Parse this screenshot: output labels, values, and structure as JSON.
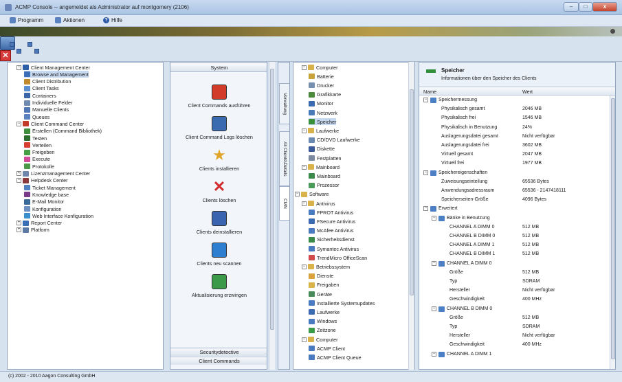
{
  "window": {
    "title": "ACMP Console -- angemeldet als Administrator auf montgomery (2106)",
    "min": "–",
    "max": "□",
    "close": "x"
  },
  "menu": [
    {
      "label": "Programm",
      "icon": "program-icon"
    },
    {
      "label": "Aktionen",
      "icon": "actions-icon"
    },
    {
      "label": "Hilfe",
      "icon": "help-icon"
    }
  ],
  "left_tree": [
    {
      "label": "Client Management Center",
      "level": 0,
      "exp": "-",
      "icon": "#2e5ea8"
    },
    {
      "label": "Browse and Management",
      "level": 1,
      "icon": "#3a6fb8",
      "selected": true
    },
    {
      "label": "Client Distribution",
      "level": 1,
      "icon": "#c48a2a"
    },
    {
      "label": "Client Tasks",
      "level": 1,
      "icon": "#5b8fcf"
    },
    {
      "label": "Containers",
      "level": 1,
      "icon": "#3a64a8"
    },
    {
      "label": "Individuelle Felder",
      "level": 1,
      "icon": "#6f8bb0"
    },
    {
      "label": "Manuelle Clients",
      "level": 1,
      "icon": "#4f78b5"
    },
    {
      "label": "Queues",
      "level": 1,
      "icon": "#5b82c0"
    },
    {
      "label": "Client Command Center",
      "level": 0,
      "exp": "-",
      "icon": "#c23b2b"
    },
    {
      "label": "Erstellen (Command Bibliothek)",
      "level": 1,
      "icon": "#3f8f3f"
    },
    {
      "label": "Testen",
      "level": 1,
      "icon": "#2d6d2d"
    },
    {
      "label": "Verteilen",
      "level": 1,
      "icon": "#d6402f"
    },
    {
      "label": "Freigeben",
      "level": 1,
      "icon": "#45a045"
    },
    {
      "label": "Execute",
      "level": 1,
      "icon": "#d04a9a"
    },
    {
      "label": "Protokolle",
      "level": 1,
      "icon": "#4a9a4a"
    },
    {
      "label": "Lizenzmanagement Center",
      "level": 0,
      "exp": "+",
      "icon": "#6f87ad"
    },
    {
      "label": "Helpdesk Center",
      "level": 0,
      "exp": "-",
      "icon": "#8a3a3a"
    },
    {
      "label": "Ticket Management",
      "level": 1,
      "icon": "#5080c0"
    },
    {
      "label": "Knowledge base",
      "level": 1,
      "icon": "#7a3a8a"
    },
    {
      "label": "E-Mail Monitor",
      "level": 1,
      "icon": "#3a6a9a"
    },
    {
      "label": "Konfiguration",
      "level": 1,
      "icon": "#6a8fc0"
    },
    {
      "label": "Web Interface Konfiguration",
      "level": 1,
      "icon": "#3a8fcf"
    },
    {
      "label": "Report Center",
      "level": 0,
      "exp": "+",
      "icon": "#3a6fb8"
    },
    {
      "label": "Platform",
      "level": 0,
      "exp": "+",
      "icon": "#5a7aa8"
    }
  ],
  "middle": {
    "header": "System",
    "actions": [
      {
        "label": "Client Commands ausführen",
        "icon": "puzzle-run-icon"
      },
      {
        "label": "Client Command Logs löschen",
        "icon": "log-delete-icon"
      },
      {
        "label": "Clients installieren",
        "icon": "install-star-icon"
      },
      {
        "label": "Clients löschen",
        "icon": "red-x-icon"
      },
      {
        "label": "Clients deinstallieren",
        "icon": "uninstall-icon"
      },
      {
        "label": "Clients neu scannen",
        "icon": "rescan-icon"
      },
      {
        "label": "Aktualisierung erzwingen",
        "icon": "force-update-icon"
      }
    ],
    "footer1": "Securitydetective",
    "footer2": "Client Commands"
  },
  "vtabs": [
    "Verwaltung",
    "All Clients\\Details",
    "CMN"
  ],
  "hw_tree": [
    {
      "label": "Computer",
      "level": 0,
      "exp": "-",
      "icon": "#d9b24a"
    },
    {
      "label": "Batterie",
      "level": 1,
      "icon": "#c8a23a"
    },
    {
      "label": "Drucker",
      "level": 1,
      "icon": "#7890b0"
    },
    {
      "label": "Grafikkarte",
      "level": 1,
      "icon": "#4a8a3a"
    },
    {
      "label": "Monitor",
      "level": 1,
      "icon": "#3a6ab0"
    },
    {
      "label": "Netzwerk",
      "level": 1,
      "icon": "#4a7ab8"
    },
    {
      "label": "Speicher",
      "level": 1,
      "icon": "#3a8f3a",
      "selected": true
    },
    {
      "label": "Laufwerke",
      "level": 0,
      "exp": "-",
      "icon": "#d9b24a"
    },
    {
      "label": "CD/DVD Laufwerke",
      "level": 1,
      "icon": "#6a8ab0"
    },
    {
      "label": "Diskette",
      "level": 1,
      "icon": "#3a5a9a"
    },
    {
      "label": "Festplatten",
      "level": 1,
      "icon": "#7a8aa0"
    },
    {
      "label": "Mainboard",
      "level": 0,
      "exp": "-",
      "icon": "#d9b24a"
    },
    {
      "label": "Mainboard",
      "level": 1,
      "icon": "#3a8a4a"
    },
    {
      "label": "Prozessor",
      "level": 1,
      "icon": "#4a9a5a"
    },
    {
      "label": "Software",
      "level": -1,
      "exp": "-",
      "icon": "#d9b24a"
    },
    {
      "label": "Antivirus",
      "level": 0,
      "exp": "-",
      "icon": "#d9b24a"
    },
    {
      "label": "FPROT Antivirus",
      "level": 1,
      "icon": "#4a7ac0"
    },
    {
      "label": "FSecure Antivirus",
      "level": 1,
      "icon": "#3a6ab0"
    },
    {
      "label": "McAfee Antivirus",
      "level": 1,
      "icon": "#4a7ac0"
    },
    {
      "label": "Sicherheitsdienst",
      "level": 1,
      "icon": "#3a8a4a"
    },
    {
      "label": "Symantec Antivirus",
      "level": 1,
      "icon": "#4a7ac0"
    },
    {
      "label": "TrendMicro OfficeScan",
      "level": 1,
      "icon": "#d04a4a"
    },
    {
      "label": "Betriebssystem",
      "level": 0,
      "exp": "-",
      "icon": "#d9b24a"
    },
    {
      "label": "Dienste",
      "level": 1,
      "icon": "#d9a23a"
    },
    {
      "label": "Freigaben",
      "level": 1,
      "icon": "#d9b24a"
    },
    {
      "label": "Geräte",
      "level": 1,
      "icon": "#4a8a5a"
    },
    {
      "label": "Installierte Systemupdates",
      "level": 1,
      "icon": "#4a7ac0"
    },
    {
      "label": "Laufwerke",
      "level": 1,
      "icon": "#3a6ab0"
    },
    {
      "label": "Windows",
      "level": 1,
      "icon": "#4a7ac0"
    },
    {
      "label": "Zeitzone",
      "level": 1,
      "icon": "#3a9a4a"
    },
    {
      "label": "Computer",
      "level": 0,
      "exp": "-",
      "icon": "#d9b24a"
    },
    {
      "label": "ACMP Client",
      "level": 1,
      "icon": "#4a7ac0"
    },
    {
      "label": "ACMP Client Queue",
      "level": 1,
      "icon": "#4a7ac0"
    }
  ],
  "details": {
    "title": "Speicher",
    "subtitle": "Informationen über den Speicher des Clients",
    "col_name": "Name",
    "col_value": "Wert",
    "rows": [
      {
        "name": "Speichermessung",
        "value": "",
        "level": 0,
        "exp": "-"
      },
      {
        "name": "Physikalisch gesamt",
        "value": "2046 MB",
        "level": 1
      },
      {
        "name": "Physikalisch frei",
        "value": "1546 MB",
        "level": 1
      },
      {
        "name": "Physikalisch in Benutzung",
        "value": "24%",
        "level": 1
      },
      {
        "name": "Auslagerungsdatei gesamt",
        "value": "Nicht verfügbar",
        "level": 1
      },
      {
        "name": "Auslagerungsdatei frei",
        "value": "3602 MB",
        "level": 1
      },
      {
        "name": "Virtuell gesamt",
        "value": "2047 MB",
        "level": 1
      },
      {
        "name": "Virtuell frei",
        "value": "1977 MB",
        "level": 1
      },
      {
        "name": "Speichereigenschaften",
        "value": "",
        "level": 0,
        "exp": "-"
      },
      {
        "name": "Zuweisungseinteilung",
        "value": "65536 Bytes",
        "level": 1
      },
      {
        "name": "Anwendungsadressraum",
        "value": "65536 - 2147418111",
        "level": 1
      },
      {
        "name": "Speicherseiten-Größe",
        "value": "4096 Bytes",
        "level": 1
      },
      {
        "name": "Erweitert",
        "value": "",
        "level": 0,
        "exp": "-"
      },
      {
        "name": "Bänke in Benutzung",
        "value": "",
        "level": 1,
        "exp": "-"
      },
      {
        "name": "CHANNEL A DIMM 0",
        "value": "512 MB",
        "level": 2
      },
      {
        "name": "CHANNEL B DIMM 0",
        "value": "512 MB",
        "level": 2
      },
      {
        "name": "CHANNEL A DIMM 1",
        "value": "512 MB",
        "level": 2
      },
      {
        "name": "CHANNEL B DIMM 1",
        "value": "512 MB",
        "level": 2
      },
      {
        "name": "CHANNEL A DIMM 0",
        "value": "",
        "level": 1,
        "exp": "-"
      },
      {
        "name": "Größe",
        "value": "512 MB",
        "level": 2
      },
      {
        "name": "Typ",
        "value": "SDRAM",
        "level": 2
      },
      {
        "name": "Hersteller",
        "value": "Nicht verfügbar",
        "level": 2
      },
      {
        "name": "Geschwindigkeit",
        "value": "400 MHz",
        "level": 2
      },
      {
        "name": "CHANNEL B DIMM 0",
        "value": "",
        "level": 1,
        "exp": "-"
      },
      {
        "name": "Größe",
        "value": "512 MB",
        "level": 2
      },
      {
        "name": "Typ",
        "value": "SDRAM",
        "level": 2
      },
      {
        "name": "Hersteller",
        "value": "Nicht verfügbar",
        "level": 2
      },
      {
        "name": "Geschwindigkeit",
        "value": "400 MHz",
        "level": 2
      },
      {
        "name": "CHANNEL A DIMM 1",
        "value": "",
        "level": 1,
        "exp": "-"
      }
    ]
  },
  "status": "(c) 2002 - 2010 Aagon Consulting GmbH"
}
